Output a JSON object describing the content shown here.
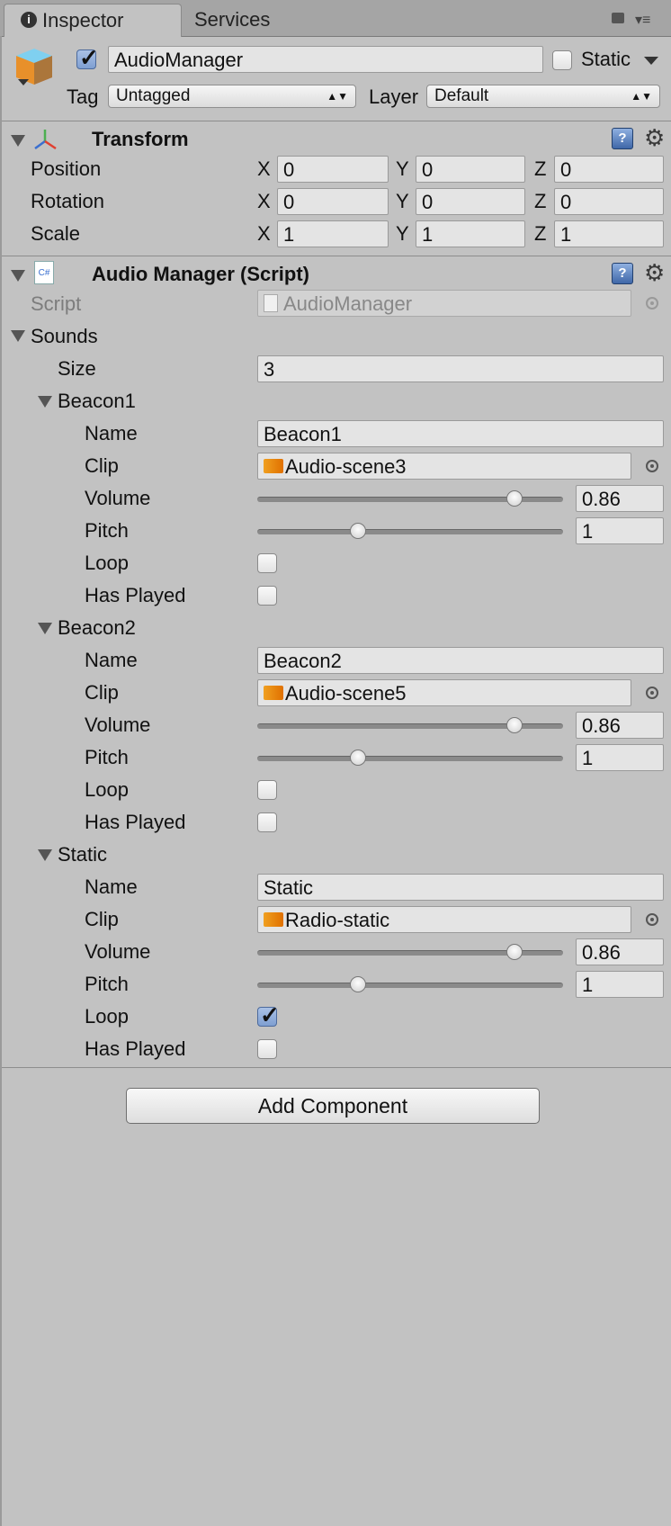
{
  "tabs": {
    "inspector": "Inspector",
    "services": "Services"
  },
  "gameobject": {
    "active": true,
    "name": "AudioManager",
    "static_label": "Static",
    "static_checked": false,
    "tag_label": "Tag",
    "tag_value": "Untagged",
    "layer_label": "Layer",
    "layer_value": "Default"
  },
  "transform": {
    "title": "Transform",
    "rows": [
      {
        "label": "Position",
        "x": "0",
        "y": "0",
        "z": "0"
      },
      {
        "label": "Rotation",
        "x": "0",
        "y": "0",
        "z": "0"
      },
      {
        "label": "Scale",
        "x": "1",
        "y": "1",
        "z": "1"
      }
    ],
    "axis": {
      "x": "X",
      "y": "Y",
      "z": "Z"
    }
  },
  "audio_manager": {
    "title": "Audio Manager (Script)",
    "script_label": "Script",
    "script_value": "AudioManager",
    "sounds_label": "Sounds",
    "size_label": "Size",
    "size_value": "3",
    "field_labels": {
      "name": "Name",
      "clip": "Clip",
      "volume": "Volume",
      "pitch": "Pitch",
      "loop": "Loop",
      "has_played": "Has Played"
    },
    "sounds": [
      {
        "header": "Beacon1",
        "name": "Beacon1",
        "clip": "Audio-scene3",
        "volume": "0.86",
        "volume_fraction": 0.86,
        "pitch": "1",
        "pitch_fraction": 0.32,
        "loop": false,
        "has_played": false
      },
      {
        "header": "Beacon2",
        "name": "Beacon2",
        "clip": "Audio-scene5",
        "volume": "0.86",
        "volume_fraction": 0.86,
        "pitch": "1",
        "pitch_fraction": 0.32,
        "loop": false,
        "has_played": false
      },
      {
        "header": "Static",
        "name": "Static",
        "clip": "Radio-static",
        "volume": "0.86",
        "volume_fraction": 0.86,
        "pitch": "1",
        "pitch_fraction": 0.32,
        "loop": true,
        "has_played": false
      }
    ]
  },
  "add_component": "Add Component"
}
